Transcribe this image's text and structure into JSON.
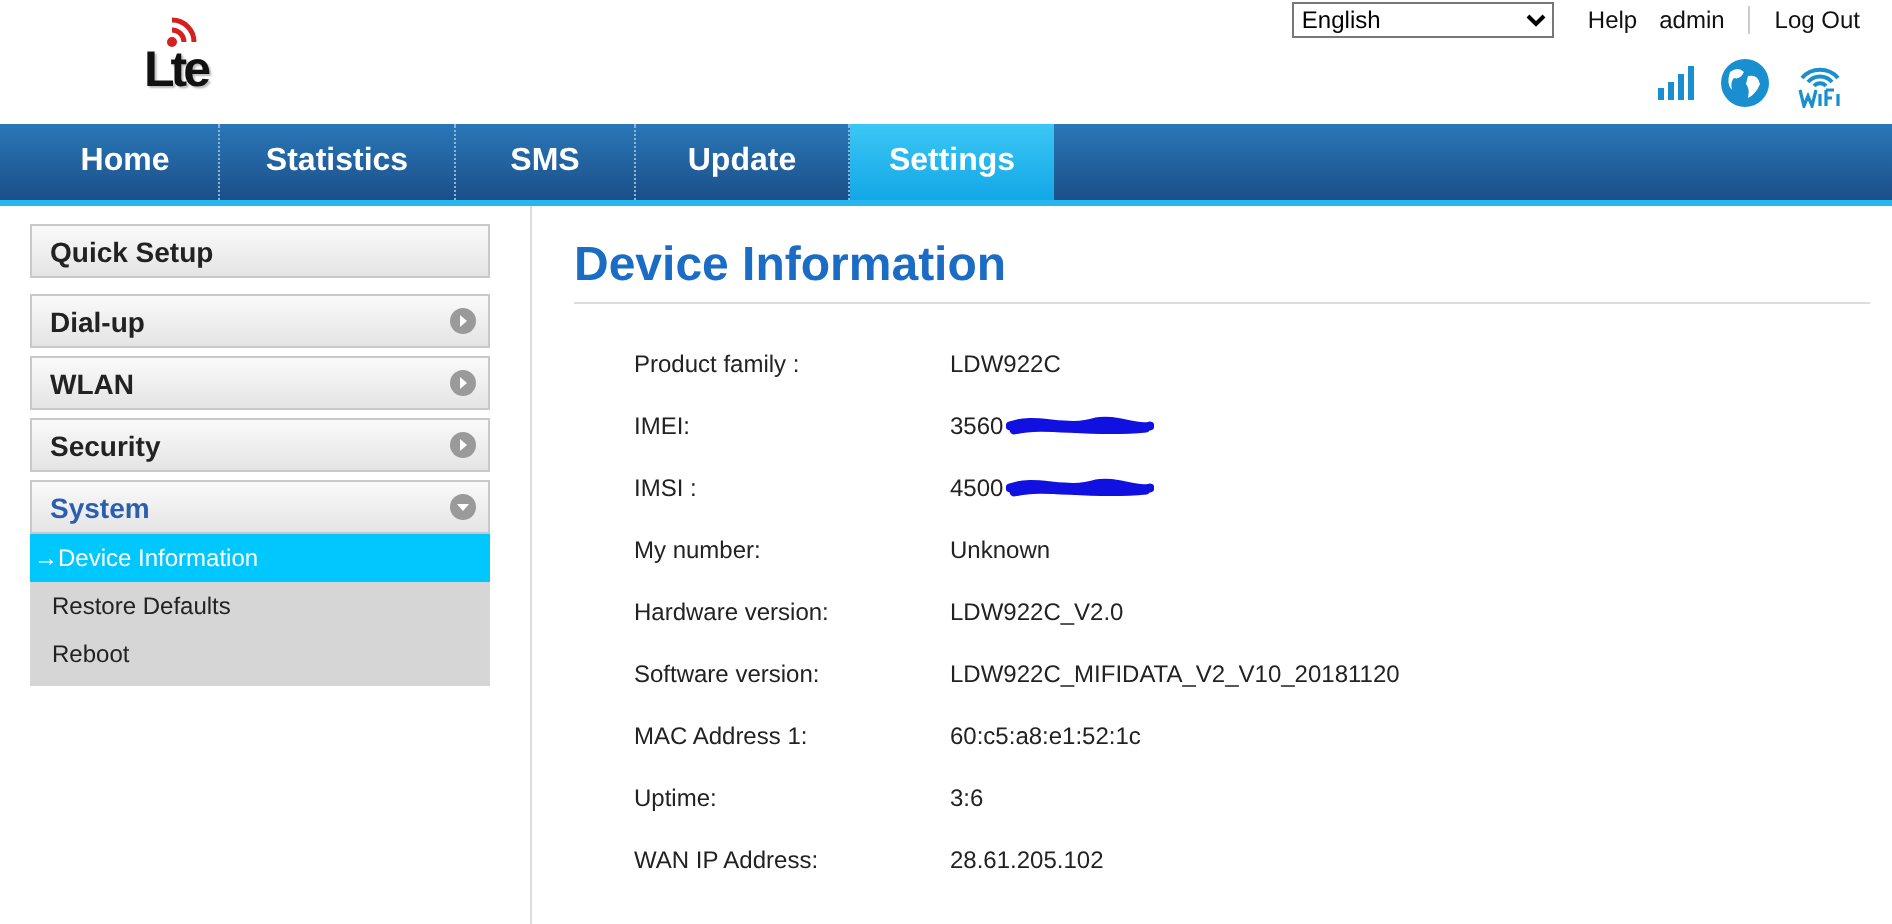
{
  "logo": {
    "text": "Lte"
  },
  "header": {
    "language": "English",
    "links": [
      "Help",
      "admin",
      "Log Out"
    ]
  },
  "tabs": [
    {
      "label": "Home",
      "selected": false
    },
    {
      "label": "Statistics",
      "selected": false
    },
    {
      "label": "SMS",
      "selected": false
    },
    {
      "label": "Update",
      "selected": false
    },
    {
      "label": "Settings",
      "selected": true
    }
  ],
  "sidebar": {
    "items": [
      {
        "label": "Quick Setup",
        "kind": "link"
      },
      {
        "label": "Dial-up",
        "kind": "menu",
        "expanded": false
      },
      {
        "label": "WLAN",
        "kind": "menu",
        "expanded": false
      },
      {
        "label": "Security",
        "kind": "menu",
        "expanded": false
      },
      {
        "label": "System",
        "kind": "menu",
        "expanded": true,
        "children": [
          {
            "label": "→Device Information",
            "selected": true
          },
          {
            "label": "Restore Defaults",
            "selected": false
          },
          {
            "label": "Reboot",
            "selected": false
          }
        ]
      }
    ]
  },
  "page": {
    "title": "Device Information",
    "rows": [
      {
        "label": "Product family :",
        "value": "LDW922C",
        "redacted": false
      },
      {
        "label": "IMEI:",
        "value": "3560",
        "redacted": true
      },
      {
        "label": "IMSI :",
        "value": "4500",
        "redacted": true
      },
      {
        "label": "My number:",
        "value": "Unknown",
        "redacted": false
      },
      {
        "label": "Hardware version:",
        "value": "LDW922C_V2.0",
        "redacted": false
      },
      {
        "label": "Software version:",
        "value": "LDW922C_MIFIDATA_V2_V10_20181120",
        "redacted": false
      },
      {
        "label": "MAC Address 1:",
        "value": "60:c5:a8:e1:52:1c",
        "redacted": false
      },
      {
        "label": "Uptime:",
        "value": "3:6",
        "redacted": false
      },
      {
        "label": "WAN IP Address:",
        "value": "28.61.205.102",
        "redacted": false
      }
    ]
  }
}
